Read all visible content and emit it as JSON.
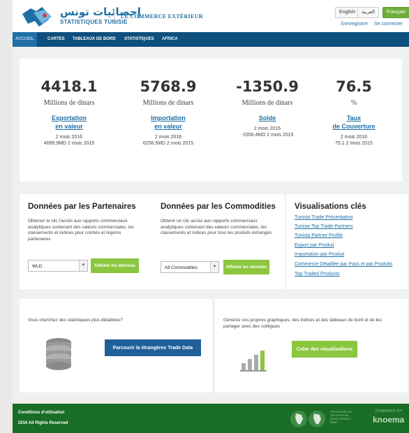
{
  "header": {
    "logo_arabic": "إحصائيات تونس",
    "logo_english": "STATISTIQUES TUNISIE",
    "site_title": "LE COMMERCE EXTÉRIEUR",
    "languages": [
      "English",
      "العربية",
      "Français"
    ],
    "active_language": "Français",
    "register": "S'enregistrer",
    "login": "Se connecter"
  },
  "nav": [
    "ACCUEIL",
    "CARTES",
    "TABLEAUX DE BORD",
    "STATISTIQUES",
    "AFRICA"
  ],
  "stats": [
    {
      "value": "4418.1",
      "unit": "Millions de dinars",
      "link_l1": "Exportation",
      "link_l2": "en valeur",
      "period": "2 mois 2016",
      "previous": "4699.9MD 2 mois 2015"
    },
    {
      "value": "5768.9",
      "unit": "Millions de dinars",
      "link_l1": "Importation",
      "link_l2": "en valeur",
      "period": "2 mois 2016",
      "previous": "6256.5MD 2 mois 2015"
    },
    {
      "value": "-1350.9",
      "unit": "Millions de dinars",
      "link_l1": "Solde",
      "link_l2": "",
      "period": "2 mois 2016",
      "previous": "-1556.4MD 2 mois 2015"
    },
    {
      "value": "76.5",
      "unit": "%",
      "link_l1": "Taux",
      "link_l2": "de Couverture",
      "period": "2 mois 2016",
      "previous": "75.1 2 mois 2015"
    }
  ],
  "partners": {
    "title": "Données par les Partenaires",
    "description": "Obtenez le clic l'accès aux rapports commerciaux analytiques contenant des valeurs commerciales, les classements et indices pour comtés et régions partenaires",
    "select_value": "WLD",
    "button": "Afficher les données"
  },
  "commodities": {
    "title": "Données par les Commodities",
    "description": "Obtenir un clic accès aux rapports commerciaux analytiques contenant des valeurs commerciales, les classements et indices pour tous les produits échangés",
    "select_value": "All Commodities",
    "button": "Afficher les données"
  },
  "visualisations": {
    "title": "Visualisations clés",
    "links": [
      "Tunisia Trade Présentation",
      "Tunisie Top Trade Partners",
      "Tunisia Partner Profile",
      "Export par Produit",
      "Importation par Produit",
      "Commerce Détaillée par Pays et par Produits",
      "Top Traded Products"
    ]
  },
  "promo_data": {
    "text": "Vous cherchez des statistiques plus détaillées?",
    "button": "Parcourir la étrangères Trade Data"
  },
  "promo_viz": {
    "text": "Générez vos propres graphiques, des indices et des tableaux de bord et de les partager avec des collègues",
    "button": "Créer des visualisations"
  },
  "footer": {
    "terms": "Conditions d'utilisation",
    "rights": "2016 All Rights Reserved",
    "sponsor_l1": "SPONSORED BY",
    "sponsor_l2": "THE AFRICAN",
    "sponsor_l3": "DEVELOPMENT",
    "sponsor_l4": "BANK",
    "powered": "POWERED BY",
    "brand": "knoema"
  },
  "colors": {
    "brand_blue": "#1f6fa6",
    "nav_blue": "#0e4f7d",
    "green_button": "#8cc63f",
    "footer_green": "#1a6d24"
  }
}
